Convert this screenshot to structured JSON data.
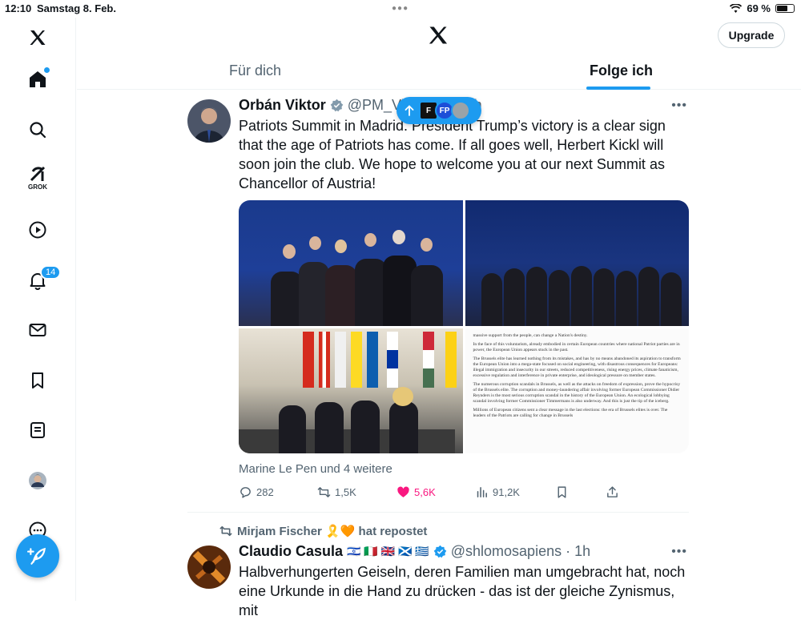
{
  "status_bar": {
    "time": "12:10",
    "date": "Samstag 8. Feb.",
    "battery": "69 %",
    "battery_level": 0.69
  },
  "header": {
    "upgrade_label": "Upgrade",
    "tabs": [
      {
        "label": "Für dich",
        "active": false
      },
      {
        "label": "Folge ich",
        "active": true
      }
    ]
  },
  "sidebar": {
    "items": [
      {
        "name": "home",
        "icon": "home-icon"
      },
      {
        "name": "search",
        "icon": "search-icon"
      },
      {
        "name": "grok",
        "icon": "grok-icon",
        "label": "GROK"
      },
      {
        "name": "video",
        "icon": "play-icon"
      },
      {
        "name": "notifications",
        "icon": "bell-icon",
        "badge": "14"
      },
      {
        "name": "messages",
        "icon": "mail-icon"
      },
      {
        "name": "bookmarks",
        "icon": "bookmark-icon"
      },
      {
        "name": "lists",
        "icon": "list-icon"
      },
      {
        "name": "profile",
        "icon": "avatar"
      },
      {
        "name": "more",
        "icon": "more-circle-icon"
      }
    ],
    "compose_icon": "feather-plus-icon"
  },
  "new_posts_pill": {
    "avatar_labels": [
      "F",
      "FP"
    ]
  },
  "tweets": [
    {
      "name": "Orbán Viktor",
      "handle": "@PM_Vi",
      "time": "h",
      "text": "Patriots Summit in Madrid. President Trump’s victory is a clear sign that the age of Patriots has come. If all goes well, Herbert Kickl will soon join the club. We hope to welcome you at our next Summit as Chancellor of Austria!",
      "liked_by": "Marine Le Pen und 4 weitere",
      "stats": {
        "replies": "282",
        "reposts": "1,5K",
        "likes": "5,6K",
        "views": "91,2K"
      },
      "document_excerpt": [
        "massive support from the people, can change a Nation's destiny.",
        "In the face of this voluntarism, already embodied in certain European countries where national Patriot parties are in power, the European Union appears stuck in the past.",
        "The Brussels elite has learned nothing from its mistakes, and has by no means abandoned its aspiration to transform the European Union into a mega-state focused on social engineering, with disastrous consequences for Europeans: illegal immigration and insecurity in our streets, reduced competitiveness, rising energy prices, climate fanaticism, excessive regulation and interference in private enterprise, and ideological pressure on member states.",
        "The numerous corruption scandals in Brussels, as well as the attacks on freedom of expression, prove the hypocrisy of the Brussels elite. The corruption and money-laundering affair involving former European Commissioner Didier Reynders is the most serious corruption scandal in the history of the European Union. An ecological lobbying scandal involving former Commissioner Timmermans is also underway. And this is just the tip of the iceberg.",
        "Millions of European citizens sent a clear message in the last elections: the era of Brussels elites is over. The leaders of the Patriots are calling for change in Brussels"
      ]
    },
    {
      "reposted_by": "Mirjam Fischer 🎗️🧡 hat repostet",
      "name": "Claudio Casula",
      "flags": "🇮🇱 🇮🇹 🇬🇧 🏴󠁧󠁢󠁳󠁣󠁴󠁿 🇬🇷",
      "handle": "@shlomosapiens",
      "time": "1h",
      "text": "Halbverhungerten Geiseln, deren Familien man umgebracht hat, noch eine Urkunde in die Hand zu drücken - das ist der gleiche Zynismus, mit"
    }
  ]
}
